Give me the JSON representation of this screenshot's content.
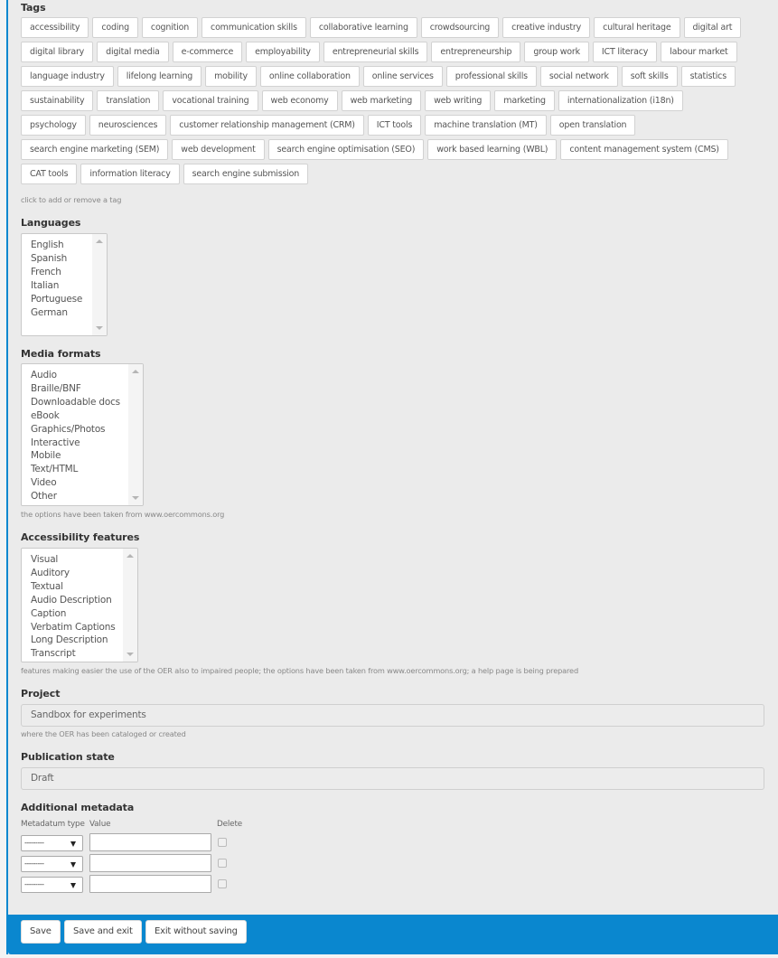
{
  "tags": {
    "label": "Tags",
    "help": "click to add or remove a tag",
    "items": [
      "accessibility",
      "coding",
      "cognition",
      "communication skills",
      "collaborative learning",
      "crowdsourcing",
      "creative industry",
      "cultural heritage",
      "digital art",
      "digital library",
      "digital media",
      "e-commerce",
      "employability",
      "entrepreneurial skills",
      "entrepreneurship",
      "group work",
      "ICT literacy",
      "labour market",
      "language industry",
      "lifelong learning",
      "mobility",
      "online collaboration",
      "online services",
      "professional skills",
      "social network",
      "soft skills",
      "statistics",
      "sustainability",
      "translation",
      "vocational training",
      "web economy",
      "web marketing",
      "web writing",
      "marketing",
      "internationalization (i18n)",
      "psychology",
      "neurosciences",
      "customer relationship management (CRM)",
      "ICT tools",
      "machine translation (MT)",
      "open translation",
      "search engine marketing (SEM)",
      "web development",
      "search engine optimisation (SEO)",
      "work based learning (WBL)",
      "content management system (CMS)",
      "CAT tools",
      "information literacy",
      "search engine submission"
    ]
  },
  "languages": {
    "label": "Languages",
    "options": [
      "English",
      "Spanish",
      "French",
      "Italian",
      "Portuguese",
      "German"
    ]
  },
  "media_formats": {
    "label": "Media formats",
    "options": [
      "Audio",
      "Braille/BNF",
      "Downloadable docs",
      "eBook",
      "Graphics/Photos",
      "Interactive",
      "Mobile",
      "Text/HTML",
      "Video",
      "Other"
    ],
    "help": "the options have been taken from www.oercommons.org"
  },
  "accessibility_features": {
    "label": "Accessibility features",
    "options": [
      "Visual",
      "Auditory",
      "Textual",
      "Audio Description",
      "Caption",
      "Verbatim Captions",
      "Long Description",
      "Transcript"
    ],
    "help": "features making easier the use of the OER also to impaired people; the options have been taken from www.oercommons.org; a help page is being prepared"
  },
  "project": {
    "label": "Project",
    "value": "Sandbox for experiments",
    "help": "where the OER has been cataloged or created"
  },
  "publication_state": {
    "label": "Publication state",
    "value": "Draft"
  },
  "additional_metadata": {
    "label": "Additional metadata",
    "col_type": "Metadatum type",
    "col_value": "Value",
    "col_delete": "Delete",
    "rows": [
      {
        "type": "---------",
        "value": "",
        "delete": false
      },
      {
        "type": "---------",
        "value": "",
        "delete": false
      },
      {
        "type": "---------",
        "value": "",
        "delete": false
      }
    ]
  },
  "footer": {
    "save": "Save",
    "save_exit": "Save and exit",
    "exit_no_save": "Exit without saving",
    "color": "#0a87cf"
  }
}
